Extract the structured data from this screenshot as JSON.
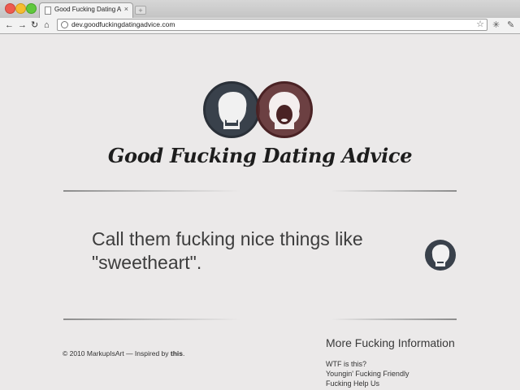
{
  "browser": {
    "tab_title": "Good Fucking Dating Advice.",
    "tab_close": "×",
    "new_tab": "+",
    "url": "dev.goodfuckingdatingadvice.com",
    "nav": {
      "back": "←",
      "forward": "→",
      "reload": "↻",
      "home": "⌂"
    },
    "star": "☆",
    "extension_icon": "✳",
    "wrench_icon": "✎"
  },
  "page": {
    "logo_title": "Good Fucking Dating Advice",
    "quote": "Call them fucking nice things like \"sweetheart\".",
    "footer": {
      "copyright_prefix": "© 2010 MarkupIsArt — Inspired by ",
      "copyright_link": "this",
      "copyright_suffix": "."
    },
    "more": {
      "heading": "More Fucking Information",
      "links": [
        "WTF is this?",
        "Youngin' Fucking Friendly",
        "Fucking Help Us"
      ]
    },
    "colors": {
      "background": "#ebe9e9",
      "male_avatar": "#39414b",
      "female_avatar": "#5a282a"
    }
  }
}
